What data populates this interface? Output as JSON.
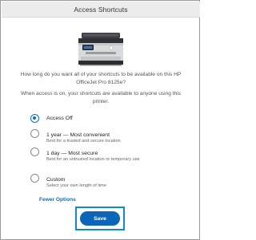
{
  "window": {
    "title": "Access Shortcuts"
  },
  "header": {
    "question": "How long do you want all of your shortcuts to be available on this HP OfficeJet Pro 8125e?",
    "info": "When access is on, your shortcuts are available to anyone using this printer."
  },
  "options": [
    {
      "title": "Access Off",
      "description": "",
      "selected": true
    },
    {
      "title": "1 year — Most convenient",
      "description": "Best for a trusted and secure location",
      "selected": false
    },
    {
      "title": "1 day — Most secure",
      "description": "Best for an untrusted location or temporary use",
      "selected": false
    },
    {
      "title": "Custom",
      "description": "Select your own length of time",
      "selected": false
    }
  ],
  "links": {
    "fewer_options": "Fewer Options"
  },
  "actions": {
    "save_label": "Save"
  },
  "colors": {
    "accent": "#0b66b8",
    "highlight_outline": "#0b8bd1",
    "link": "#0a6bc2"
  },
  "icons": {
    "printer": "printer-image"
  }
}
